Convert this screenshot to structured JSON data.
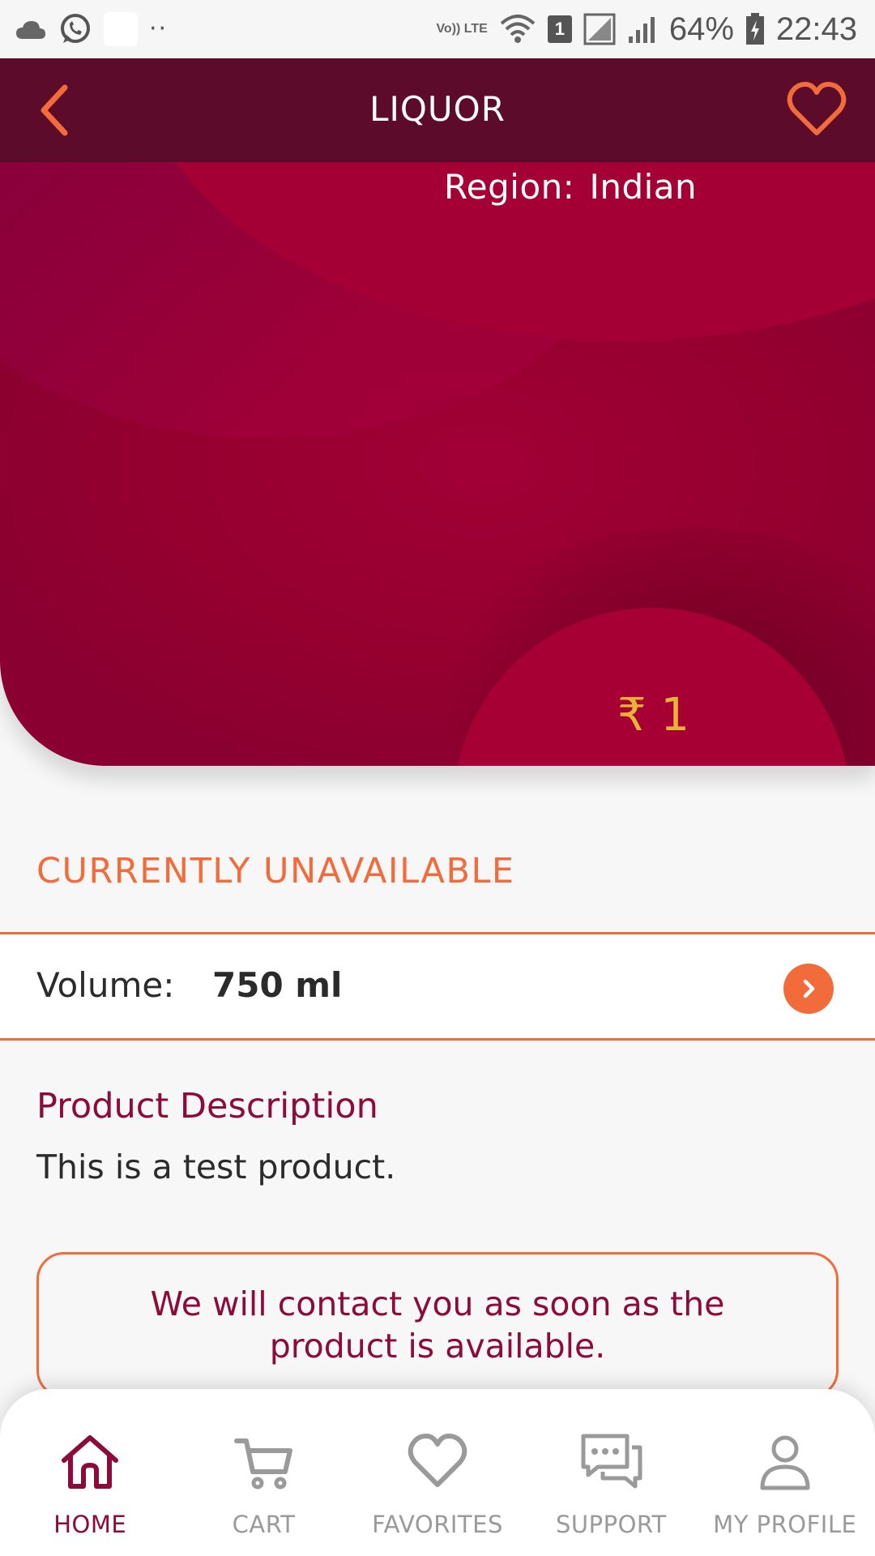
{
  "status_bar": {
    "network_label": "Vo)) LTE",
    "sim_label": "1",
    "battery": "64%",
    "time": "22:43",
    "icons": [
      "cloud-icon",
      "whatsapp-icon",
      "wifi-icon",
      "signal-icon",
      "battery-charging-icon"
    ]
  },
  "header": {
    "title": "LIQUOR",
    "back_icon": "chevron-left-icon",
    "favorite_icon": "heart-outline-icon"
  },
  "product": {
    "region_label": "Region:",
    "region_value": "Indian",
    "price": "₹ 1",
    "availability": "CURRENTLY UNAVAILABLE",
    "volume_label": "Volume:",
    "volume_value": "750 ml",
    "description_title": "Product Description",
    "description_text": "This is a test product.",
    "notice": "We will contact you as soon as the product is available."
  },
  "bottom_nav": {
    "items": [
      {
        "label": "HOME",
        "icon": "home-icon",
        "active": true
      },
      {
        "label": "CART",
        "icon": "cart-icon",
        "active": false
      },
      {
        "label": "FAVORITES",
        "icon": "heart-icon",
        "active": false
      },
      {
        "label": "SUPPORT",
        "icon": "chat-icon",
        "active": false
      },
      {
        "label": "MY PROFILE",
        "icon": "user-icon",
        "active": false
      }
    ]
  },
  "colors": {
    "brand_dark": "#5c0b2a",
    "brand_crimson": "#a00036",
    "accent_orange": "#f26b3a",
    "price_gold": "#e7b43b",
    "active_nav": "#8c0b3a",
    "inactive_nav": "#9a9a9a"
  }
}
